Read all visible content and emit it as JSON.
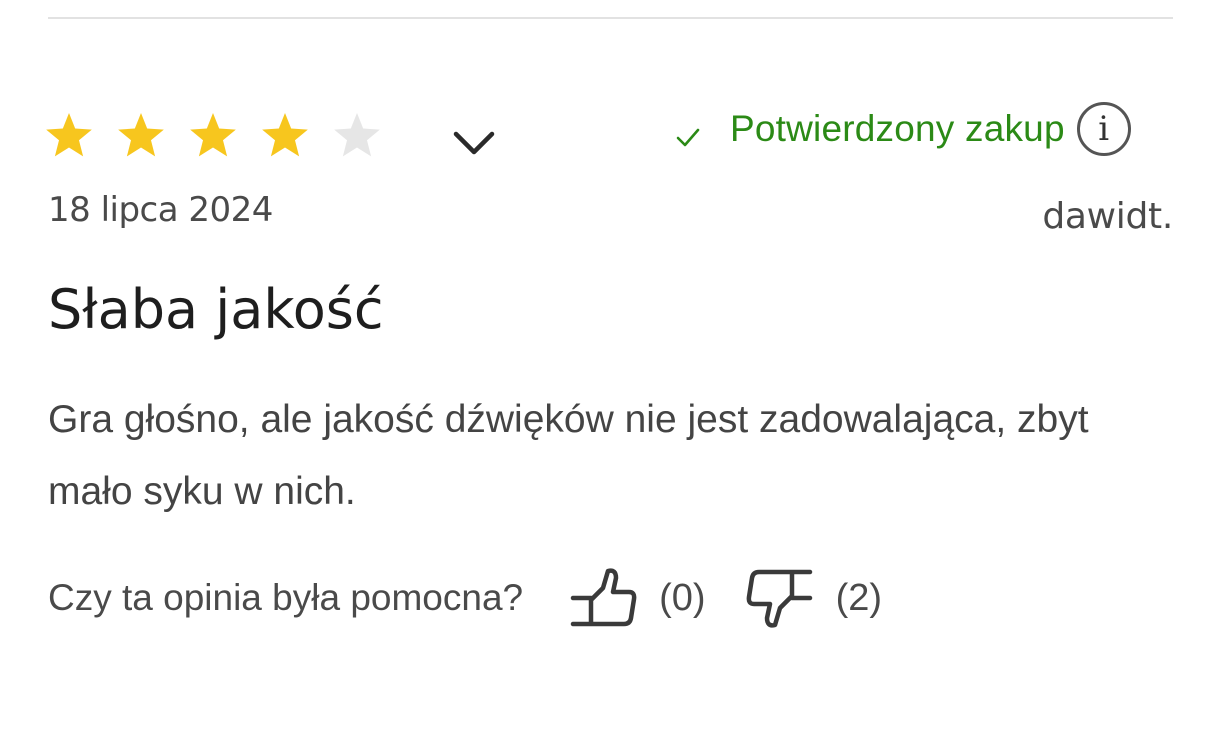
{
  "review": {
    "rating": 4,
    "rating_max": 5,
    "star_color_filled": "#f7c61e",
    "star_color_empty": "#e6e6e6",
    "expand_icon": "chevron-down-icon",
    "verified": {
      "label": "Potwierdzony zakup",
      "color": "#2b8a16",
      "check_icon": "check-icon",
      "info_icon": "info-icon",
      "info_glyph": "i"
    },
    "date": "18 lipca 2024",
    "author": "dawidt.",
    "title": "Słaba jakość",
    "text": "Gra głośno, ale jakość dźwięków nie jest zadowalająca, zbyt mało syku w nich.",
    "helpful": {
      "question": "Czy ta opinia była pomocna?",
      "up_icon": "thumbs-up-icon",
      "up_count": "(0)",
      "down_icon": "thumbs-down-icon",
      "down_count": "(2)"
    }
  }
}
